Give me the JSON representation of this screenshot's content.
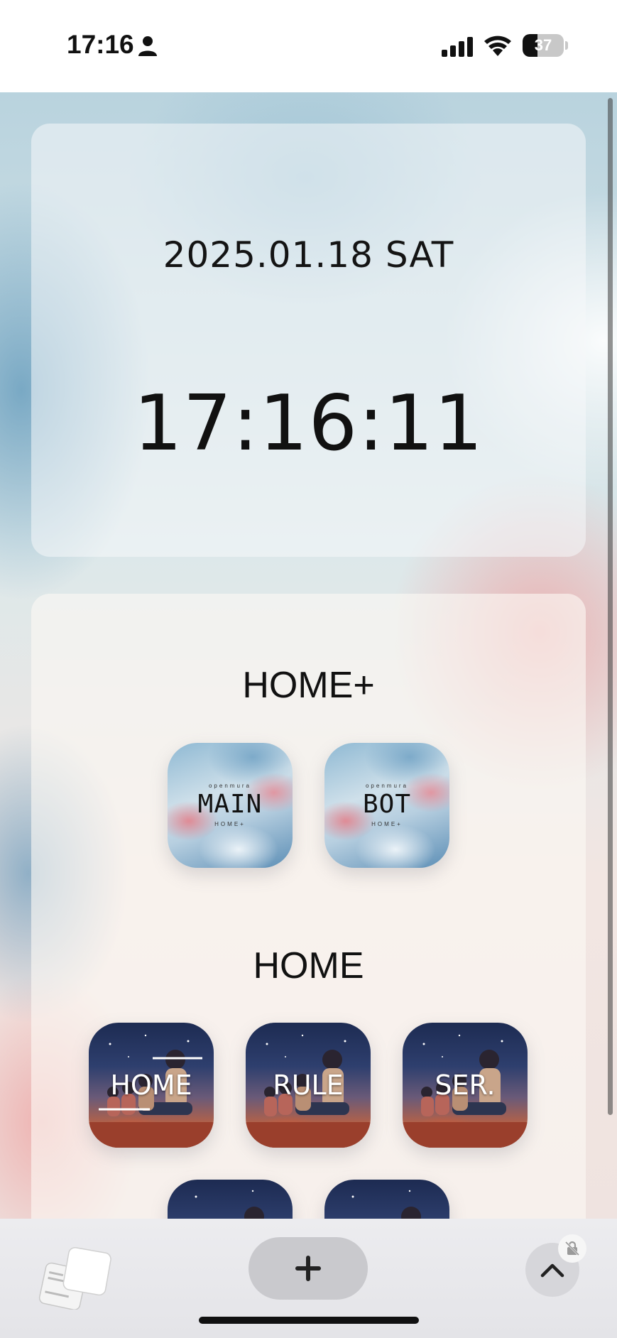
{
  "status_bar": {
    "time": "17:16",
    "battery": "37",
    "battery_level": 0.37,
    "icons": [
      "person-icon",
      "cellular-signal-icon",
      "wifi-icon",
      "battery-icon"
    ]
  },
  "clock_card": {
    "date": "2025.01.18 SAT",
    "time": "17:16:11"
  },
  "home_plus": {
    "title": "HOME+",
    "tiles": [
      {
        "label": "MAIN",
        "top_text": "openmura",
        "bottom_text": "HOME+"
      },
      {
        "label": "BOT",
        "top_text": "openmura",
        "bottom_text": "HOME+"
      }
    ]
  },
  "home": {
    "title": "HOME",
    "tiles": [
      {
        "label": "HOME"
      },
      {
        "label": "RULE"
      },
      {
        "label": "SER."
      }
    ]
  },
  "toolbar": {
    "icons": [
      "tabs-icon",
      "plus-icon",
      "chevron-up-icon",
      "lock-slash-icon"
    ]
  },
  "colors": {
    "text": "#111111",
    "toolbar_bg": "#e6e6ea",
    "plus_pill": "#c9c9cd"
  }
}
